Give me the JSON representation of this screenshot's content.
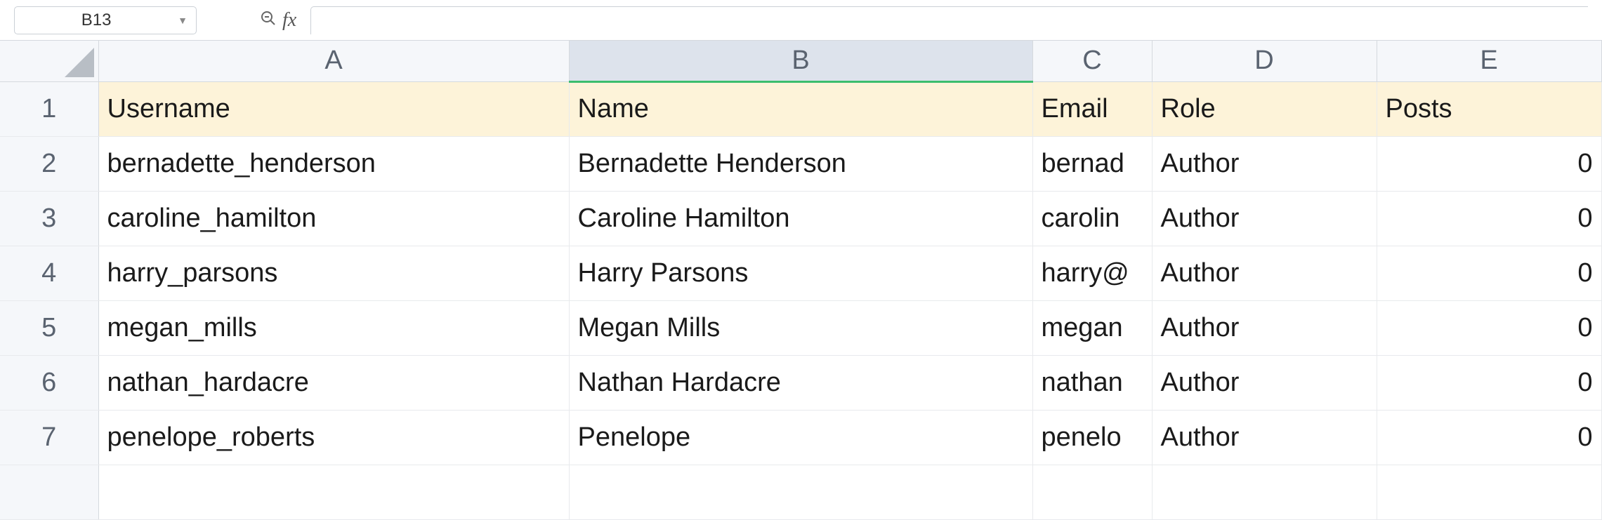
{
  "formula_bar": {
    "cell_ref": "B13",
    "fx_label": "fx",
    "formula_value": ""
  },
  "columns": [
    {
      "letter": "A",
      "selected": false
    },
    {
      "letter": "B",
      "selected": true
    },
    {
      "letter": "C",
      "selected": false
    },
    {
      "letter": "D",
      "selected": false
    },
    {
      "letter": "E",
      "selected": false
    }
  ],
  "row_numbers": [
    "1",
    "2",
    "3",
    "4",
    "5",
    "6",
    "7"
  ],
  "header_row": {
    "A": "Username",
    "B": "Name",
    "C": "Email",
    "D": "Role",
    "E": "Posts"
  },
  "rows": [
    {
      "A": "bernadette_henderson",
      "B": "Bernadette Henderson",
      "C": "bernad",
      "D": "Author",
      "E": "0"
    },
    {
      "A": "caroline_hamilton",
      "B": "Caroline Hamilton",
      "C": "carolin",
      "D": "Author",
      "E": "0"
    },
    {
      "A": "harry_parsons",
      "B": "Harry Parsons",
      "C": "harry@",
      "D": "Author",
      "E": "0"
    },
    {
      "A": "megan_mills",
      "B": "Megan Mills",
      "C": "megan",
      "D": "Author",
      "E": "0"
    },
    {
      "A": "nathan_hardacre",
      "B": "Nathan Hardacre",
      "C": "nathan",
      "D": "Author",
      "E": "0"
    },
    {
      "A": "penelope_roberts",
      "B": "Penelope",
      "C": "penelo",
      "D": "Author",
      "E": "0"
    }
  ]
}
